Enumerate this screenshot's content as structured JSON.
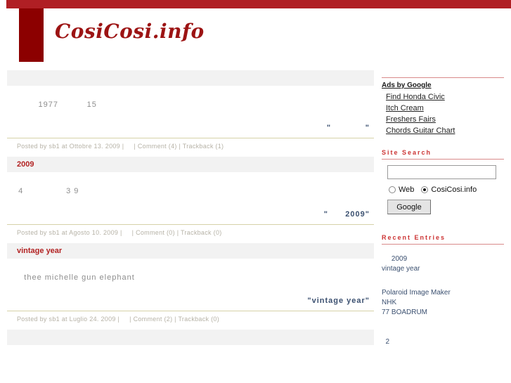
{
  "site": {
    "title": "CosiCosi.info",
    "brand_color": "#9c1313",
    "bar_color": "#b01f24",
    "block_color": "#8c0000"
  },
  "entries": [
    {
      "title": "",
      "lines": [
        "          1977          15"
      ],
      "quote": "\"            \"",
      "footer": "Posted by sb1 at Ottobre 13. 2009 |     | Comment (4) | Trackback (1)"
    },
    {
      "title": "2009",
      "lines": [
        "   4               3 9"
      ],
      "quote": "\"      2009\"",
      "footer": "Posted by sb1 at Agosto 10. 2009 |     | Comment (0) | Trackback (0)"
    },
    {
      "title": "vintage year",
      "lines": [
        "     thee michelle gun elephant"
      ],
      "quote": "\"vintage year\"",
      "footer": "Posted by sb1 at Luglio 24. 2009 |     | Comment (2) | Trackback (0)"
    },
    {
      "title": "",
      "lines": [],
      "quote": "",
      "footer": ""
    }
  ],
  "sidebar": {
    "ads": {
      "heading": "Ads by Google",
      "links": [
        "Find Honda Civic",
        "Itch Cream",
        "Freshers Fairs",
        "Chords Guitar Chart"
      ]
    },
    "search": {
      "heading": "Site Search",
      "value": "",
      "placeholder": "",
      "option_web": "Web",
      "option_site": "CosiCosi.info",
      "selected": "CosiCosi.info",
      "button_label": "Google"
    },
    "recent": {
      "heading": "Recent Entries",
      "items": [
        "     2009",
        "vintage year",
        "",
        "",
        "Polaroid Image Maker",
        "NHK",
        "77 BOADRUM"
      ],
      "tail": "  2"
    }
  }
}
